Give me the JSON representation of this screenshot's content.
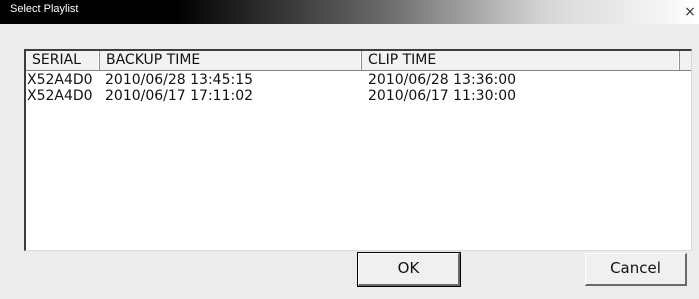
{
  "window": {
    "title": "Select Playlist",
    "close_symbol": "×"
  },
  "list": {
    "columns": [
      "SERIAL",
      "BACKUP TIME",
      "CLIP TIME"
    ],
    "rows": [
      {
        "serial": "X52A4D0",
        "backup_time": "2010/06/28 13:45:15",
        "clip_time": "2010/06/28 13:36:00"
      },
      {
        "serial": "X52A4D0",
        "backup_time": "2010/06/17 17:11:02",
        "clip_time": "2010/06/17 11:30:00"
      }
    ]
  },
  "buttons": {
    "ok_label": "OK",
    "cancel_label": "Cancel"
  }
}
